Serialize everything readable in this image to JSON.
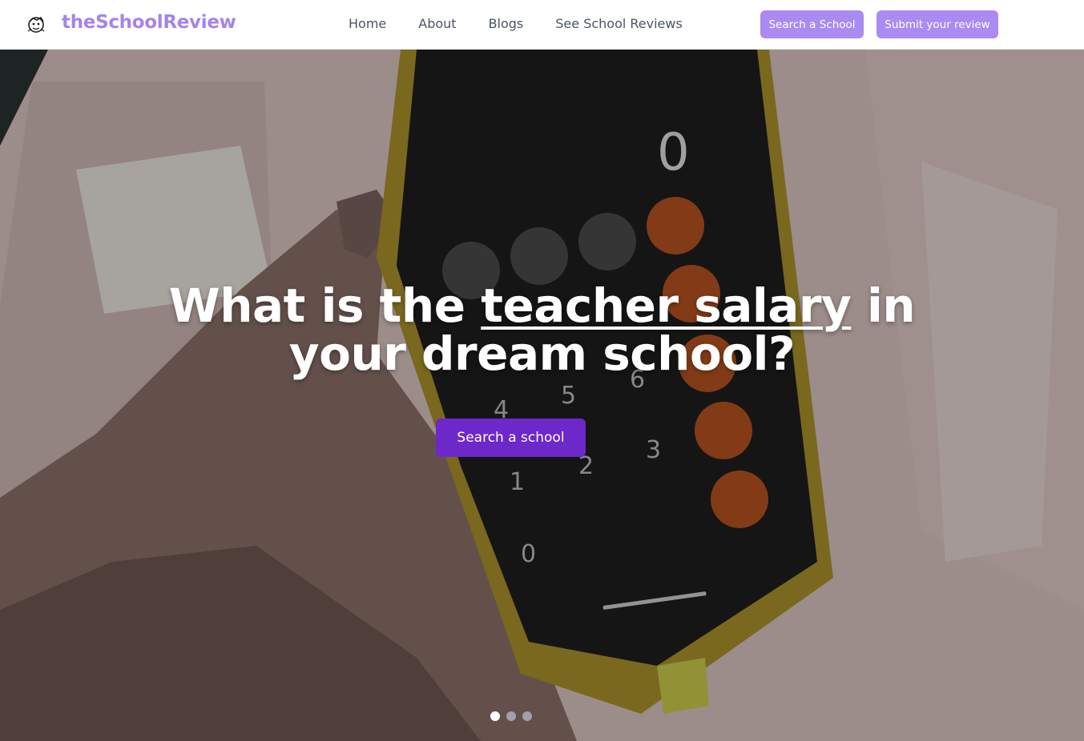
{
  "nav": {
    "brand": "theSchoolReview",
    "links": [
      "Home",
      "About",
      "Blogs",
      "See School Reviews"
    ],
    "search_button": "Search a School",
    "review_button": "Submit your review"
  },
  "hero": {
    "headline_pre": "What is the ",
    "headline_highlight": "teacher salary",
    "headline_post": " in",
    "headline_line2": "your dream school?",
    "cta": "Search a school",
    "carousel_active_index": 0,
    "carousel_count": 3
  },
  "colors": {
    "brand": "#a385ea",
    "top_button": "#a98bf2",
    "cta": "#6d28c9"
  },
  "icons": [
    "logo-mascot-icon"
  ]
}
